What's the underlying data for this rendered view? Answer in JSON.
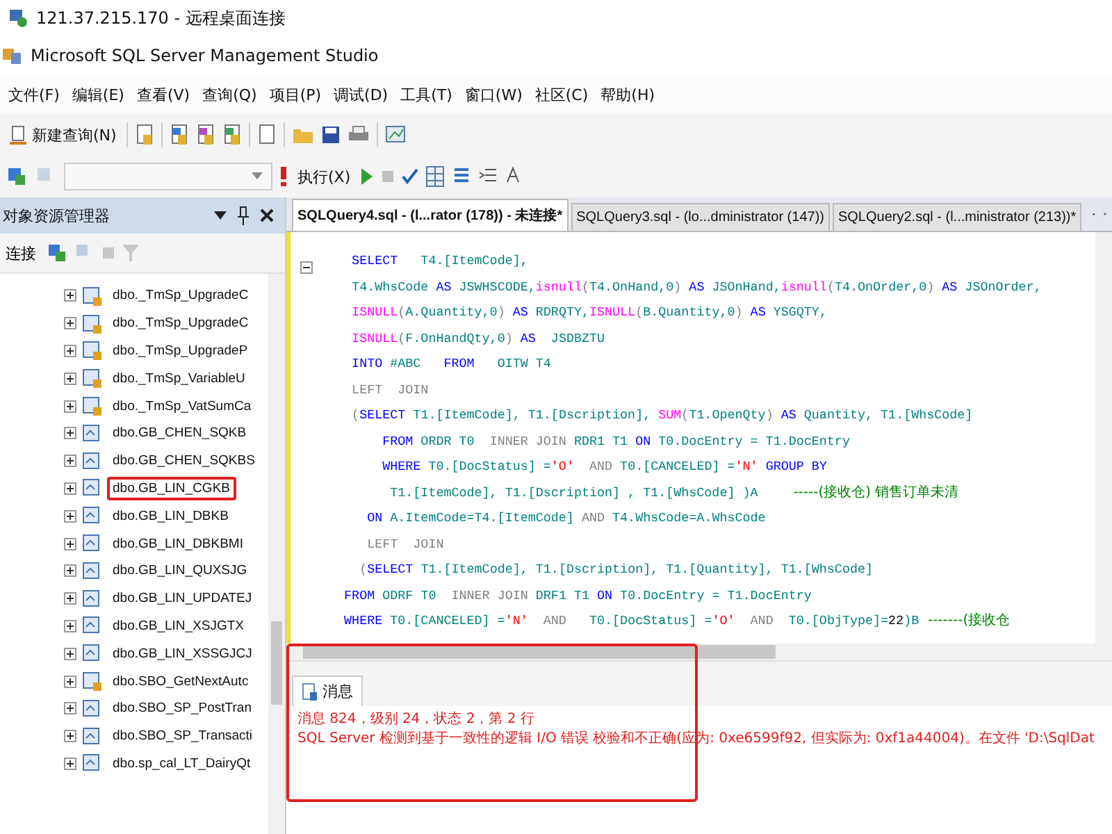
{
  "remote_window": {
    "title": "121.37.215.170 - 远程桌面连接"
  },
  "app_window": {
    "title": "Microsoft SQL Server Management Studio"
  },
  "menu": [
    "文件(F)",
    "编辑(E)",
    "查看(V)",
    "查询(Q)",
    "项目(P)",
    "调试(D)",
    "工具(T)",
    "窗口(W)",
    "社区(C)",
    "帮助(H)"
  ],
  "toolbar": {
    "new_query": "新建查询(N)",
    "execute": "执行(X)"
  },
  "object_explorer": {
    "title": "对象资源管理器",
    "connect": "连接",
    "items": [
      {
        "name": "dbo._TmSp_UpgradeC",
        "kind": "system",
        "expanded": false,
        "annotated": false
      },
      {
        "name": "dbo._TmSp_UpgradeC",
        "kind": "system",
        "expanded": false,
        "annotated": false
      },
      {
        "name": "dbo._TmSp_UpgradeP",
        "kind": "system",
        "expanded": false,
        "annotated": false
      },
      {
        "name": "dbo._TmSp_VariableU",
        "kind": "system",
        "expanded": false,
        "annotated": false
      },
      {
        "name": "dbo._TmSp_VatSumCa",
        "kind": "system",
        "expanded": false,
        "annotated": false
      },
      {
        "name": "dbo.GB_CHEN_SQKB",
        "kind": "user",
        "expanded": false,
        "annotated": false
      },
      {
        "name": "dbo.GB_CHEN_SQKBS",
        "kind": "user",
        "expanded": false,
        "annotated": false
      },
      {
        "name": "dbo.GB_LIN_CGKB",
        "kind": "user",
        "expanded": false,
        "annotated": true
      },
      {
        "name": "dbo.GB_LIN_DBKB",
        "kind": "user",
        "expanded": false,
        "annotated": false
      },
      {
        "name": "dbo.GB_LIN_DBKBMI",
        "kind": "user",
        "expanded": false,
        "annotated": false
      },
      {
        "name": "dbo.GB_LIN_QUXSJG",
        "kind": "user",
        "expanded": false,
        "annotated": false
      },
      {
        "name": "dbo.GB_LIN_UPDATEJ",
        "kind": "user",
        "expanded": false,
        "annotated": false
      },
      {
        "name": "dbo.GB_LIN_XSJGTX",
        "kind": "user",
        "expanded": false,
        "annotated": false
      },
      {
        "name": "dbo.GB_LIN_XSSGJCJ",
        "kind": "user",
        "expanded": false,
        "annotated": false
      },
      {
        "name": "dbo.SBO_GetNextAutc",
        "kind": "system",
        "expanded": false,
        "annotated": false
      },
      {
        "name": "dbo.SBO_SP_PostTran",
        "kind": "user",
        "expanded": false,
        "annotated": false
      },
      {
        "name": "dbo.SBO_SP_Transacti",
        "kind": "user",
        "expanded": false,
        "annotated": false
      },
      {
        "name": "dbo.sp_cal_LT_DairyQt",
        "kind": "user",
        "expanded": false,
        "annotated": false
      }
    ]
  },
  "tabs": [
    {
      "label": "SQLQuery4.sql - (l...rator (178)) - 未连接*",
      "selected": true
    },
    {
      "label": "SQLQuery3.sql - (lo...dministrator (147))",
      "selected": false
    },
    {
      "label": "SQLQuery2.sql - (l...ministrator (213))*",
      "selected": false
    }
  ],
  "code_lines": [
    [
      {
        "kind": "kw",
        "text": "    SELECT"
      },
      {
        "kind": "id",
        "text": "   T4.[ItemCode],"
      }
    ],
    [
      {
        "kind": "id",
        "text": "    T4.WhsCode "
      },
      {
        "kind": "kw",
        "text": "AS"
      },
      {
        "kind": "id",
        "text": " JSWHSCODE,"
      },
      {
        "kind": "fn",
        "text": "isnull"
      },
      {
        "kind": "op",
        "text": "("
      },
      {
        "kind": "id",
        "text": "T4.OnHand,0"
      },
      {
        "kind": "op",
        "text": ")"
      },
      {
        "kind": "kw",
        "text": " AS"
      },
      {
        "kind": "id",
        "text": " JSOnHand,"
      },
      {
        "kind": "fn",
        "text": "isnull"
      },
      {
        "kind": "op",
        "text": "("
      },
      {
        "kind": "id",
        "text": "T4.OnOrder,0"
      },
      {
        "kind": "op",
        "text": ")"
      },
      {
        "kind": "kw",
        "text": " AS"
      },
      {
        "kind": "id",
        "text": " JSOnOrder,"
      }
    ],
    [
      {
        "kind": "fn",
        "text": "    ISNULL"
      },
      {
        "kind": "op",
        "text": "("
      },
      {
        "kind": "id",
        "text": "A.Quantity,0"
      },
      {
        "kind": "op",
        "text": ")"
      },
      {
        "kind": "kw",
        "text": " AS"
      },
      {
        "kind": "id",
        "text": " RDRQTY,"
      },
      {
        "kind": "fn",
        "text": "ISNULL"
      },
      {
        "kind": "op",
        "text": "("
      },
      {
        "kind": "id",
        "text": "B.Quantity,0"
      },
      {
        "kind": "op",
        "text": ")"
      },
      {
        "kind": "kw",
        "text": " AS"
      },
      {
        "kind": "id",
        "text": " YSGQTY,"
      }
    ],
    [
      {
        "kind": "fn",
        "text": "    ISNULL"
      },
      {
        "kind": "op",
        "text": "("
      },
      {
        "kind": "id",
        "text": "F.OnHandQty,0"
      },
      {
        "kind": "op",
        "text": ")"
      },
      {
        "kind": "kw",
        "text": " AS"
      },
      {
        "kind": "id",
        "text": "  JSDBZTU"
      }
    ],
    [
      {
        "kind": "kw",
        "text": "    INTO"
      },
      {
        "kind": "id",
        "text": " #ABC   "
      },
      {
        "kind": "kw",
        "text": "FROM"
      },
      {
        "kind": "id",
        "text": "   OITW T4"
      }
    ],
    [
      {
        "kind": "op",
        "text": "    LEFT  JOIN"
      }
    ],
    [
      {
        "kind": "op",
        "text": "    ("
      },
      {
        "kind": "kw",
        "text": "SELECT"
      },
      {
        "kind": "id",
        "text": " T1.[ItemCode], T1.[Dscription], "
      },
      {
        "kind": "fn",
        "text": "SUM"
      },
      {
        "kind": "op",
        "text": "("
      },
      {
        "kind": "id",
        "text": "T1.OpenQty"
      },
      {
        "kind": "op",
        "text": ")"
      },
      {
        "kind": "kw",
        "text": " AS"
      },
      {
        "kind": "id",
        "text": " Quantity, T1.[WhsCode]"
      }
    ],
    [
      {
        "kind": "kw",
        "text": "        FROM"
      },
      {
        "kind": "id",
        "text": " ORDR T0  "
      },
      {
        "kind": "op",
        "text": "INNER JOIN"
      },
      {
        "kind": "id",
        "text": " RDR1 T1 "
      },
      {
        "kind": "kw",
        "text": "ON"
      },
      {
        "kind": "id",
        "text": " T0.DocEntry = T1.DocEntry"
      }
    ],
    [
      {
        "kind": "kw",
        "text": "        WHERE"
      },
      {
        "kind": "id",
        "text": " T0.[DocStatus] ="
      },
      {
        "kind": "str",
        "text": "'O'"
      },
      {
        "kind": "op",
        "text": "  AND"
      },
      {
        "kind": "id",
        "text": " T0.[CANCELED] ="
      },
      {
        "kind": "str",
        "text": "'N'"
      },
      {
        "kind": "kw",
        "text": " GROUP BY"
      }
    ],
    [
      {
        "kind": "id",
        "text": "         T1.[ItemCode], T1.[Dscription] , T1.[WhsCode] )A"
      },
      {
        "kind": "cmt",
        "text": "        -----(接收仓) 销售订单未清"
      }
    ],
    [
      {
        "kind": "kw",
        "text": "      ON"
      },
      {
        "kind": "id",
        "text": " A.ItemCode=T4.[ItemCode] "
      },
      {
        "kind": "op",
        "text": "AND"
      },
      {
        "kind": "id",
        "text": " T4.WhsCode=A.WhsCode"
      }
    ],
    [
      {
        "kind": "op",
        "text": "      LEFT  JOIN"
      }
    ],
    [
      {
        "kind": "op",
        "text": "     ("
      },
      {
        "kind": "kw",
        "text": "SELECT"
      },
      {
        "kind": "id",
        "text": " T1.[ItemCode], T1.[Dscription], T1.[Quantity], T1.[WhsCode]"
      }
    ],
    [
      {
        "kind": "kw",
        "text": "   FROM"
      },
      {
        "kind": "id",
        "text": " ODRF T0  "
      },
      {
        "kind": "op",
        "text": "INNER JOIN"
      },
      {
        "kind": "id",
        "text": " DRF1 T1 "
      },
      {
        "kind": "kw",
        "text": "ON"
      },
      {
        "kind": "id",
        "text": " T0.DocEntry = T1.DocEntry"
      }
    ],
    [
      {
        "kind": "kw",
        "text": "   WHERE"
      },
      {
        "kind": "id",
        "text": " T0.[CANCELED] ="
      },
      {
        "kind": "str",
        "text": "'N'"
      },
      {
        "kind": "op",
        "text": "  AND"
      },
      {
        "kind": "id",
        "text": "   T0.[DocStatus] ="
      },
      {
        "kind": "str",
        "text": "'O'"
      },
      {
        "kind": "op",
        "text": "  AND"
      },
      {
        "kind": "id",
        "text": "  T0.[ObjType]="
      },
      {
        "kind": "num",
        "text": "22"
      },
      {
        "kind": "id",
        "text": ")B"
      },
      {
        "kind": "cmt",
        "text": "  -------(接收仓"
      }
    ]
  ],
  "messages": {
    "tab": "消息",
    "annotated": true,
    "lines": [
      "消息 824，级别 24，状态 2，第 2 行",
      "SQL Server 检测到基于一致性的逻辑 I/O 错误 校验和不正确(应为: 0xe6599f92, 但实际为: 0xf1a44004)。在文件 'D:\\SqlDat"
    ]
  }
}
